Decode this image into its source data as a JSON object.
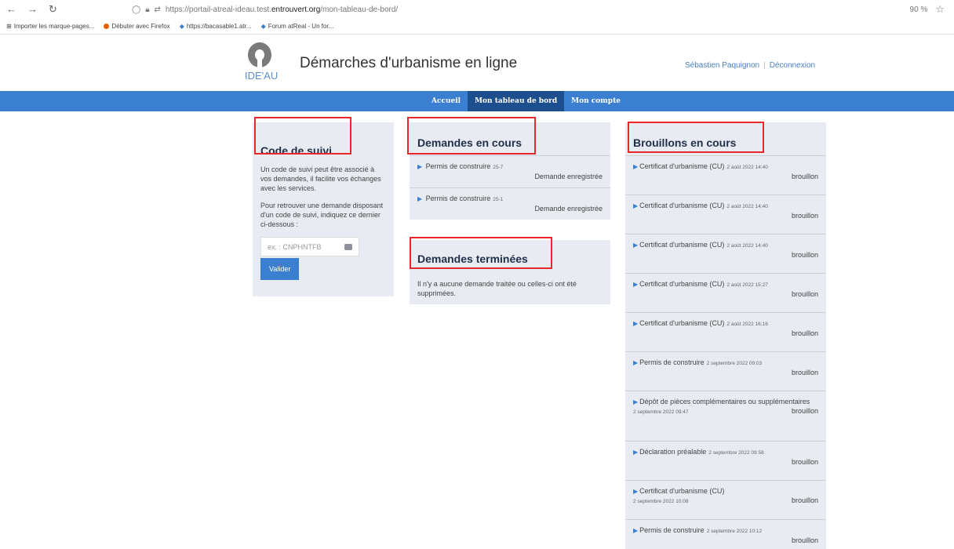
{
  "browser": {
    "url_prefix": "https://portail-atreal-ideau.test.",
    "url_host": "entrouvert.org",
    "url_path": "/mon-tableau-de-bord/",
    "zoom": "90 %",
    "bookmarks": [
      {
        "label": "Importer les marque-pages..."
      },
      {
        "label": "Débuter avec Firefox"
      },
      {
        "label": "https://bacasable1.atr..."
      },
      {
        "label": "Forum atReal - Un for..."
      }
    ]
  },
  "header": {
    "logo_text": "IDE'AU",
    "title": "Démarches d'urbanisme en ligne",
    "user_name": "Sébastien Paquignon",
    "logout": "Déconnexion"
  },
  "navbar": {
    "items": [
      {
        "label": "Accueil"
      },
      {
        "label": "Mon tableau de bord"
      },
      {
        "label": "Mon compte"
      }
    ]
  },
  "code_suivi": {
    "title": "Code de suivi",
    "para1": "Un code de suivi peut être associé à vos demandes, il facilite vos échanges avec les services.",
    "para2": "Pour retrouver une demande disposant d'un code de suivi, indiquez ce dernier ci-dessous :",
    "placeholder": "ex. : CNPHNTFB",
    "button": "Valider"
  },
  "demandes_en_cours": {
    "title": "Demandes en cours",
    "items": [
      {
        "label": "Permis de construire",
        "id": "25-7",
        "status": "Demande enregistrée"
      },
      {
        "label": "Permis de construire",
        "id": "25-1",
        "status": "Demande enregistrée"
      }
    ]
  },
  "demandes_terminees": {
    "title": "Demandes terminées",
    "message": "Il n'y a aucune demande traitée ou celles-ci ont été supprimées."
  },
  "brouillons": {
    "title": "Brouillons en cours",
    "items": [
      {
        "label": "Certificat d'urbanisme (CU)",
        "date": "2 août 2022 14:40",
        "status": "brouillon"
      },
      {
        "label": "Certificat d'urbanisme (CU)",
        "date": "2 août 2022 14:40",
        "status": "brouillon"
      },
      {
        "label": "Certificat d'urbanisme (CU)",
        "date": "2 août 2022 14:40",
        "status": "brouillon"
      },
      {
        "label": "Certificat d'urbanisme (CU)",
        "date": "2 août 2022 15:27",
        "status": "brouillon"
      },
      {
        "label": "Certificat d'urbanisme (CU)",
        "date": "2 août 2022 16:16",
        "status": "brouillon"
      },
      {
        "label": "Permis de construire",
        "date": "2 septembre 2022 09:03",
        "status": "brouillon"
      },
      {
        "label": "Dépôt de pièces complémentaires ou supplémentaires",
        "date": "2 septembre 2022 09:47",
        "status": "brouillon"
      },
      {
        "label": "Déclaration préalable",
        "date": "2 septembre 2022 09:58",
        "status": "brouillon"
      },
      {
        "label": "Certificat d'urbanisme (CU)",
        "date": "2 septembre 2022 10:08",
        "status": "brouillon"
      },
      {
        "label": "Permis de construire",
        "date": "2 septembre 2022 10:12",
        "status": "brouillon"
      }
    ]
  },
  "colors": {
    "accent": "#3b7fd0",
    "nav_active": "#1d4f8e",
    "highlight_box": "#e8262b",
    "panel_bg": "#e9ebf2"
  }
}
